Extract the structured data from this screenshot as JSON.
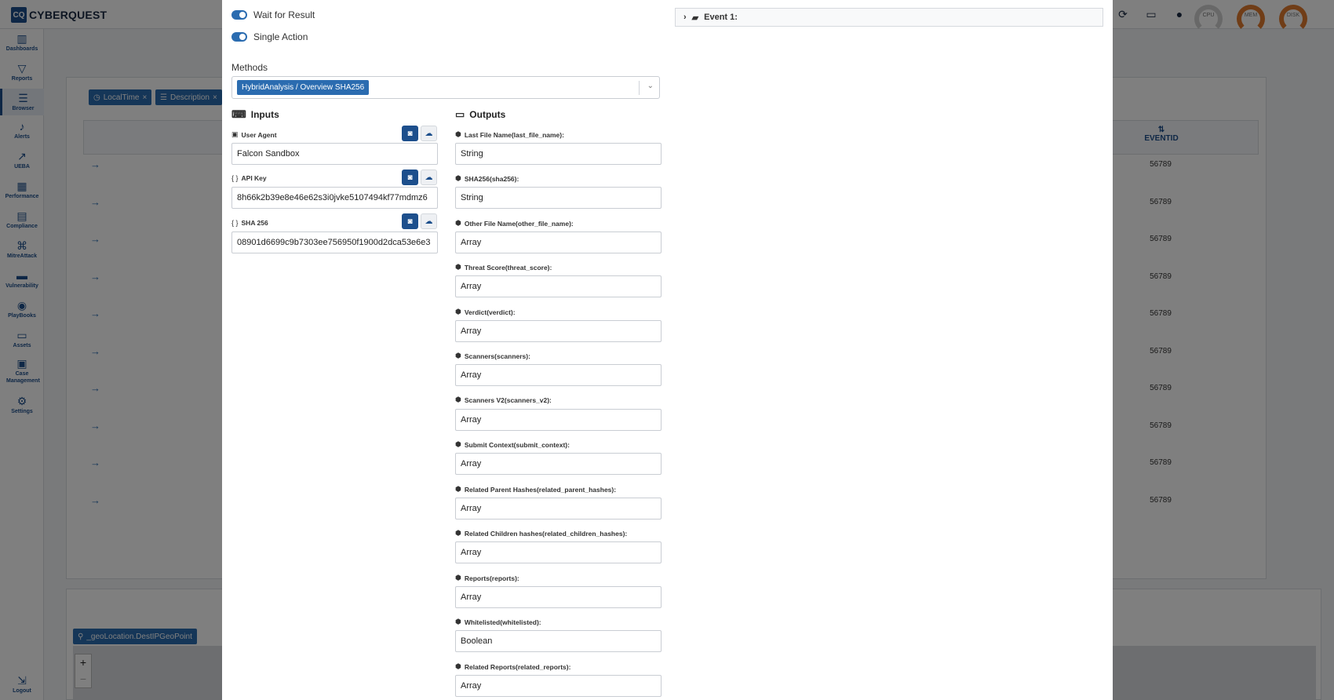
{
  "app": {
    "logo_mark": "CQ",
    "logo_text": "CYBERQUEST",
    "gauges": [
      {
        "label": "CPU",
        "hot": false
      },
      {
        "label": "MEM",
        "hot": true
      },
      {
        "label": "DISK",
        "hot": true
      }
    ]
  },
  "sidebar": {
    "items": [
      {
        "label": "Dashboards",
        "icon": "▥"
      },
      {
        "label": "Reports",
        "icon": "▽"
      },
      {
        "label": "Browser",
        "icon": "☰"
      },
      {
        "label": "Alerts",
        "icon": "♪"
      },
      {
        "label": "UEBA",
        "icon": "↗"
      },
      {
        "label": "Performance",
        "icon": "▦"
      },
      {
        "label": "Compliance",
        "icon": "▤"
      },
      {
        "label": "MitreAttack",
        "icon": "⌘"
      },
      {
        "label": "Vulnerability",
        "icon": "▬"
      },
      {
        "label": "PlayBooks",
        "icon": "◉"
      },
      {
        "label": "Assets",
        "icon": "▭"
      },
      {
        "label": "Case Management",
        "icon": "▣"
      },
      {
        "label": "Settings",
        "icon": "⚙"
      },
      {
        "label": "Logout",
        "icon": "⇲"
      }
    ]
  },
  "browser": {
    "filters": [
      {
        "icon": "◷",
        "label": "LocalTime"
      },
      {
        "icon": "☰",
        "label": "Description"
      }
    ],
    "eventid_header": "EVENTID",
    "rows": [
      "56789",
      "56789",
      "56789",
      "56789",
      "56789",
      "56789",
      "56789",
      "56789",
      "56789",
      "56789"
    ],
    "geo_chip": "_geoLocation.DestIPGeoPoint",
    "zoom_in": "+",
    "zoom_out": "−"
  },
  "modal": {
    "wait_for_result": "Wait for Result",
    "single_action": "Single Action",
    "methods_label": "Methods",
    "method_selected": "HybridAnalysis / Overview SHA256",
    "inputs_title": "Inputs",
    "outputs_title": "Outputs",
    "event_title": "Event 1:",
    "inputs": [
      {
        "icon": "▣",
        "label": "User Agent",
        "value": "Falcon Sandbox"
      },
      {
        "icon": "{ }",
        "label": "API Key",
        "value": "8h66k2b39e8e46e62s3i0jvke5107494kf77mdmz6"
      },
      {
        "icon": "{ }",
        "label": "SHA 256",
        "value": "08901d6699c9b7303ee756950f1900d2dca53e6e3"
      }
    ],
    "outputs": [
      {
        "label": "Last File Name(last_file_name):",
        "value": "String"
      },
      {
        "label": "SHA256(sha256):",
        "value": "String"
      },
      {
        "label": "Other File Name(other_file_name):",
        "value": "Array"
      },
      {
        "label": "Threat Score(threat_score):",
        "value": "Array"
      },
      {
        "label": "Verdict(verdict):",
        "value": "Array"
      },
      {
        "label": "Scanners(scanners):",
        "value": "Array"
      },
      {
        "label": "Scanners V2(scanners_v2):",
        "value": "Array"
      },
      {
        "label": "Submit Context(submit_context):",
        "value": "Array"
      },
      {
        "label": "Related Parent Hashes(related_parent_hashes):",
        "value": "Array"
      },
      {
        "label": "Related Children hashes(related_children_hashes):",
        "value": "Array"
      },
      {
        "label": "Reports(reports):",
        "value": "Array"
      },
      {
        "label": "Whitelisted(whitelisted):",
        "value": "Boolean"
      },
      {
        "label": "Related Reports(related_reports):",
        "value": "Array"
      }
    ]
  }
}
